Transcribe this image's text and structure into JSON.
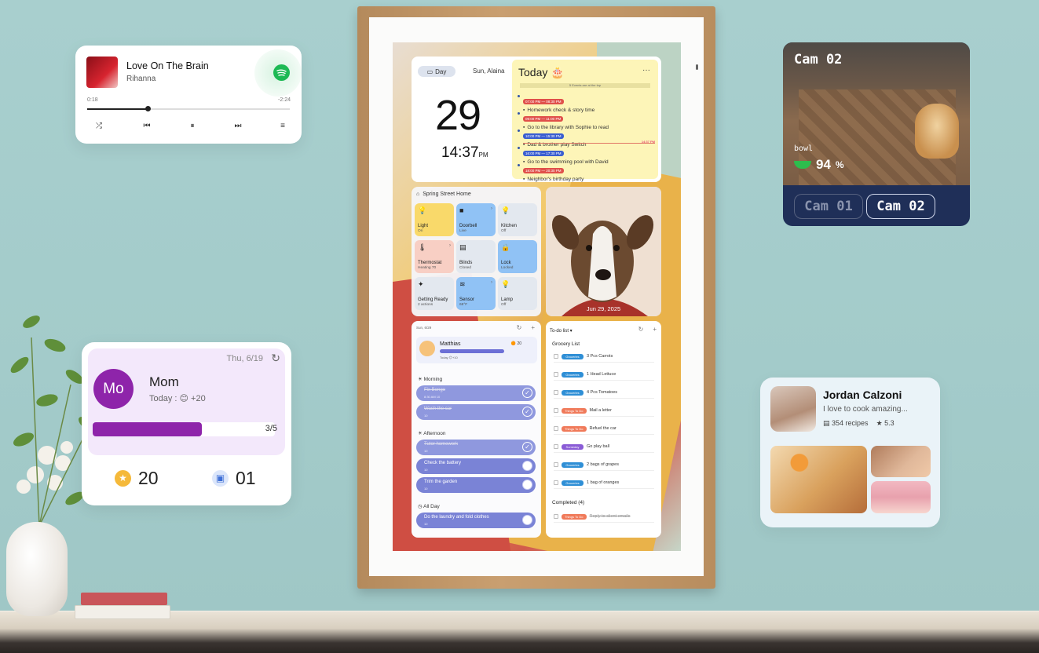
{
  "music": {
    "song": "Love On The Brain",
    "artist": "Rihanna",
    "elapsed": "0:18",
    "remaining": "-2:24",
    "progress": 0.3,
    "controls": [
      "shuffle-icon",
      "previous-icon",
      "pause-icon",
      "next-icon",
      "queue-icon"
    ],
    "accent": "#1db954"
  },
  "camera": {
    "title": "Cam 02",
    "bowl_label": "bowl",
    "bowl_value": "94",
    "bowl_unit": "%",
    "buttons": [
      "Cam 01",
      "Cam 02"
    ],
    "active": "Cam 02"
  },
  "mom_widget": {
    "date": "Thu, 6/19",
    "avatar": "Mo",
    "name": "Mom",
    "subtitle": "Today : 😊 +20",
    "progress_label": "3/5",
    "progress": 0.6,
    "stars": "20",
    "gifts": "01",
    "accent": "#8e24aa"
  },
  "recipe_widget": {
    "name": "Jordan Calzoni",
    "bio": "I love to cook amazing...",
    "recipes": "354 recipes",
    "rating": "5.3"
  },
  "clock": {
    "view_pill": "Day",
    "date_line": "Sun, Alaina",
    "day": "29",
    "time": "14:37",
    "ampm": "PM"
  },
  "today": {
    "title": "Today",
    "sub": "5 Events are at the top",
    "events": [
      {
        "time": "07:00 PM — 08:30 PM",
        "name": "Homework check & story time",
        "color": "#e0504a"
      },
      {
        "time": "09:00 PM — 11:00 PM",
        "name": "Go to the library with Sophie to read",
        "color": "#e0504a"
      },
      {
        "time": "10:00 PM — 15:30 PM",
        "name": "Dad & brother play Switch",
        "color": "#3a5ed0"
      },
      {
        "time": "16:00 PM — 17:30 PM",
        "name": "Go to the swimming pool with David",
        "color": "#3a5ed0"
      },
      {
        "time": "18:00 PM — 20:30 PM",
        "name": "Neighbor's birthday party",
        "color": "#e0504a"
      }
    ],
    "now_label": "14:37 PM"
  },
  "home": {
    "title": "Spring Street Home",
    "tiles": [
      {
        "label": "Light",
        "state": "On",
        "icon": "bulb-icon",
        "color": "#f9d96a"
      },
      {
        "label": "Doorbell",
        "state": "Live",
        "icon": "camera-icon",
        "color": "#90c2f5"
      },
      {
        "label": "Kitchen",
        "state": "Off",
        "icon": "bulb-icon",
        "color": "#e3e8ef"
      },
      {
        "label": "Thermostat",
        "state": "Heating 70",
        "icon": "thermometer-icon",
        "color": "#f8cfc4"
      },
      {
        "label": "Blinds",
        "state": "Closed",
        "icon": "blinds-icon",
        "color": "#e3e8ef"
      },
      {
        "label": "Lock",
        "state": "Locked",
        "icon": "lock-icon",
        "color": "#90c2f5"
      },
      {
        "label": "Getting Ready",
        "state": "2 actions",
        "icon": "sparkle-icon",
        "color": "#e3e8ef"
      },
      {
        "label": "Sensor",
        "state": "68°F",
        "icon": "wifi-icon",
        "color": "#90c2f5"
      },
      {
        "label": "Lamp",
        "state": "Off",
        "icon": "bulb-icon",
        "color": "#e3e8ef"
      }
    ]
  },
  "photo": {
    "date": "Jun 29, 2025"
  },
  "chores": {
    "header": "Sun, 6/29",
    "profile_name": "Matthias",
    "profile_sub": "Today  😊+10",
    "profile_score": "20",
    "morning_label": "Morning",
    "afternoon_label": "Afternoon",
    "allday_label": "All Day",
    "morning": [
      {
        "name": "Fix Bongo",
        "sub": "8:30 AM  10",
        "done": true
      },
      {
        "name": "Wash the car",
        "sub": "10",
        "done": true
      }
    ],
    "afternoon": [
      {
        "name": "Tutor homework",
        "sub": "10",
        "done": true
      },
      {
        "name": "Check the battery",
        "sub": "10",
        "done": false
      },
      {
        "name": "Trim the garden",
        "sub": "10",
        "done": false
      }
    ],
    "allday": [
      {
        "name": "Do the laundry and fold clothes",
        "sub": "10",
        "done": false
      }
    ]
  },
  "todo": {
    "header": "To-do list",
    "section": "Grocery List",
    "items": [
      {
        "tag": "Groceries",
        "text": "3 Pcs Carrots",
        "color": "#2f8fd6"
      },
      {
        "tag": "Groceries",
        "text": "1 Head Lettuce",
        "color": "#2f8fd6"
      },
      {
        "tag": "Groceries",
        "text": "4 Pcs Tomatoes",
        "color": "#2f8fd6"
      },
      {
        "tag": "Things To Do",
        "text": "Mail a letter",
        "color": "#f07a5a"
      },
      {
        "tag": "Things To Do",
        "text": "Refuel the car",
        "color": "#f07a5a"
      },
      {
        "tag": "Someday",
        "text": "Go play ball",
        "color": "#8a5cd6"
      },
      {
        "tag": "Groceries",
        "text": "2 bags of grapes",
        "color": "#2f8fd6"
      },
      {
        "tag": "Groceries",
        "text": "1 bag of oranges",
        "color": "#2f8fd6"
      }
    ],
    "completed_label": "Completed (4)",
    "completed": [
      {
        "tag": "Things To Do",
        "text": "Reply to client emails",
        "color": "#f07a5a"
      }
    ]
  }
}
